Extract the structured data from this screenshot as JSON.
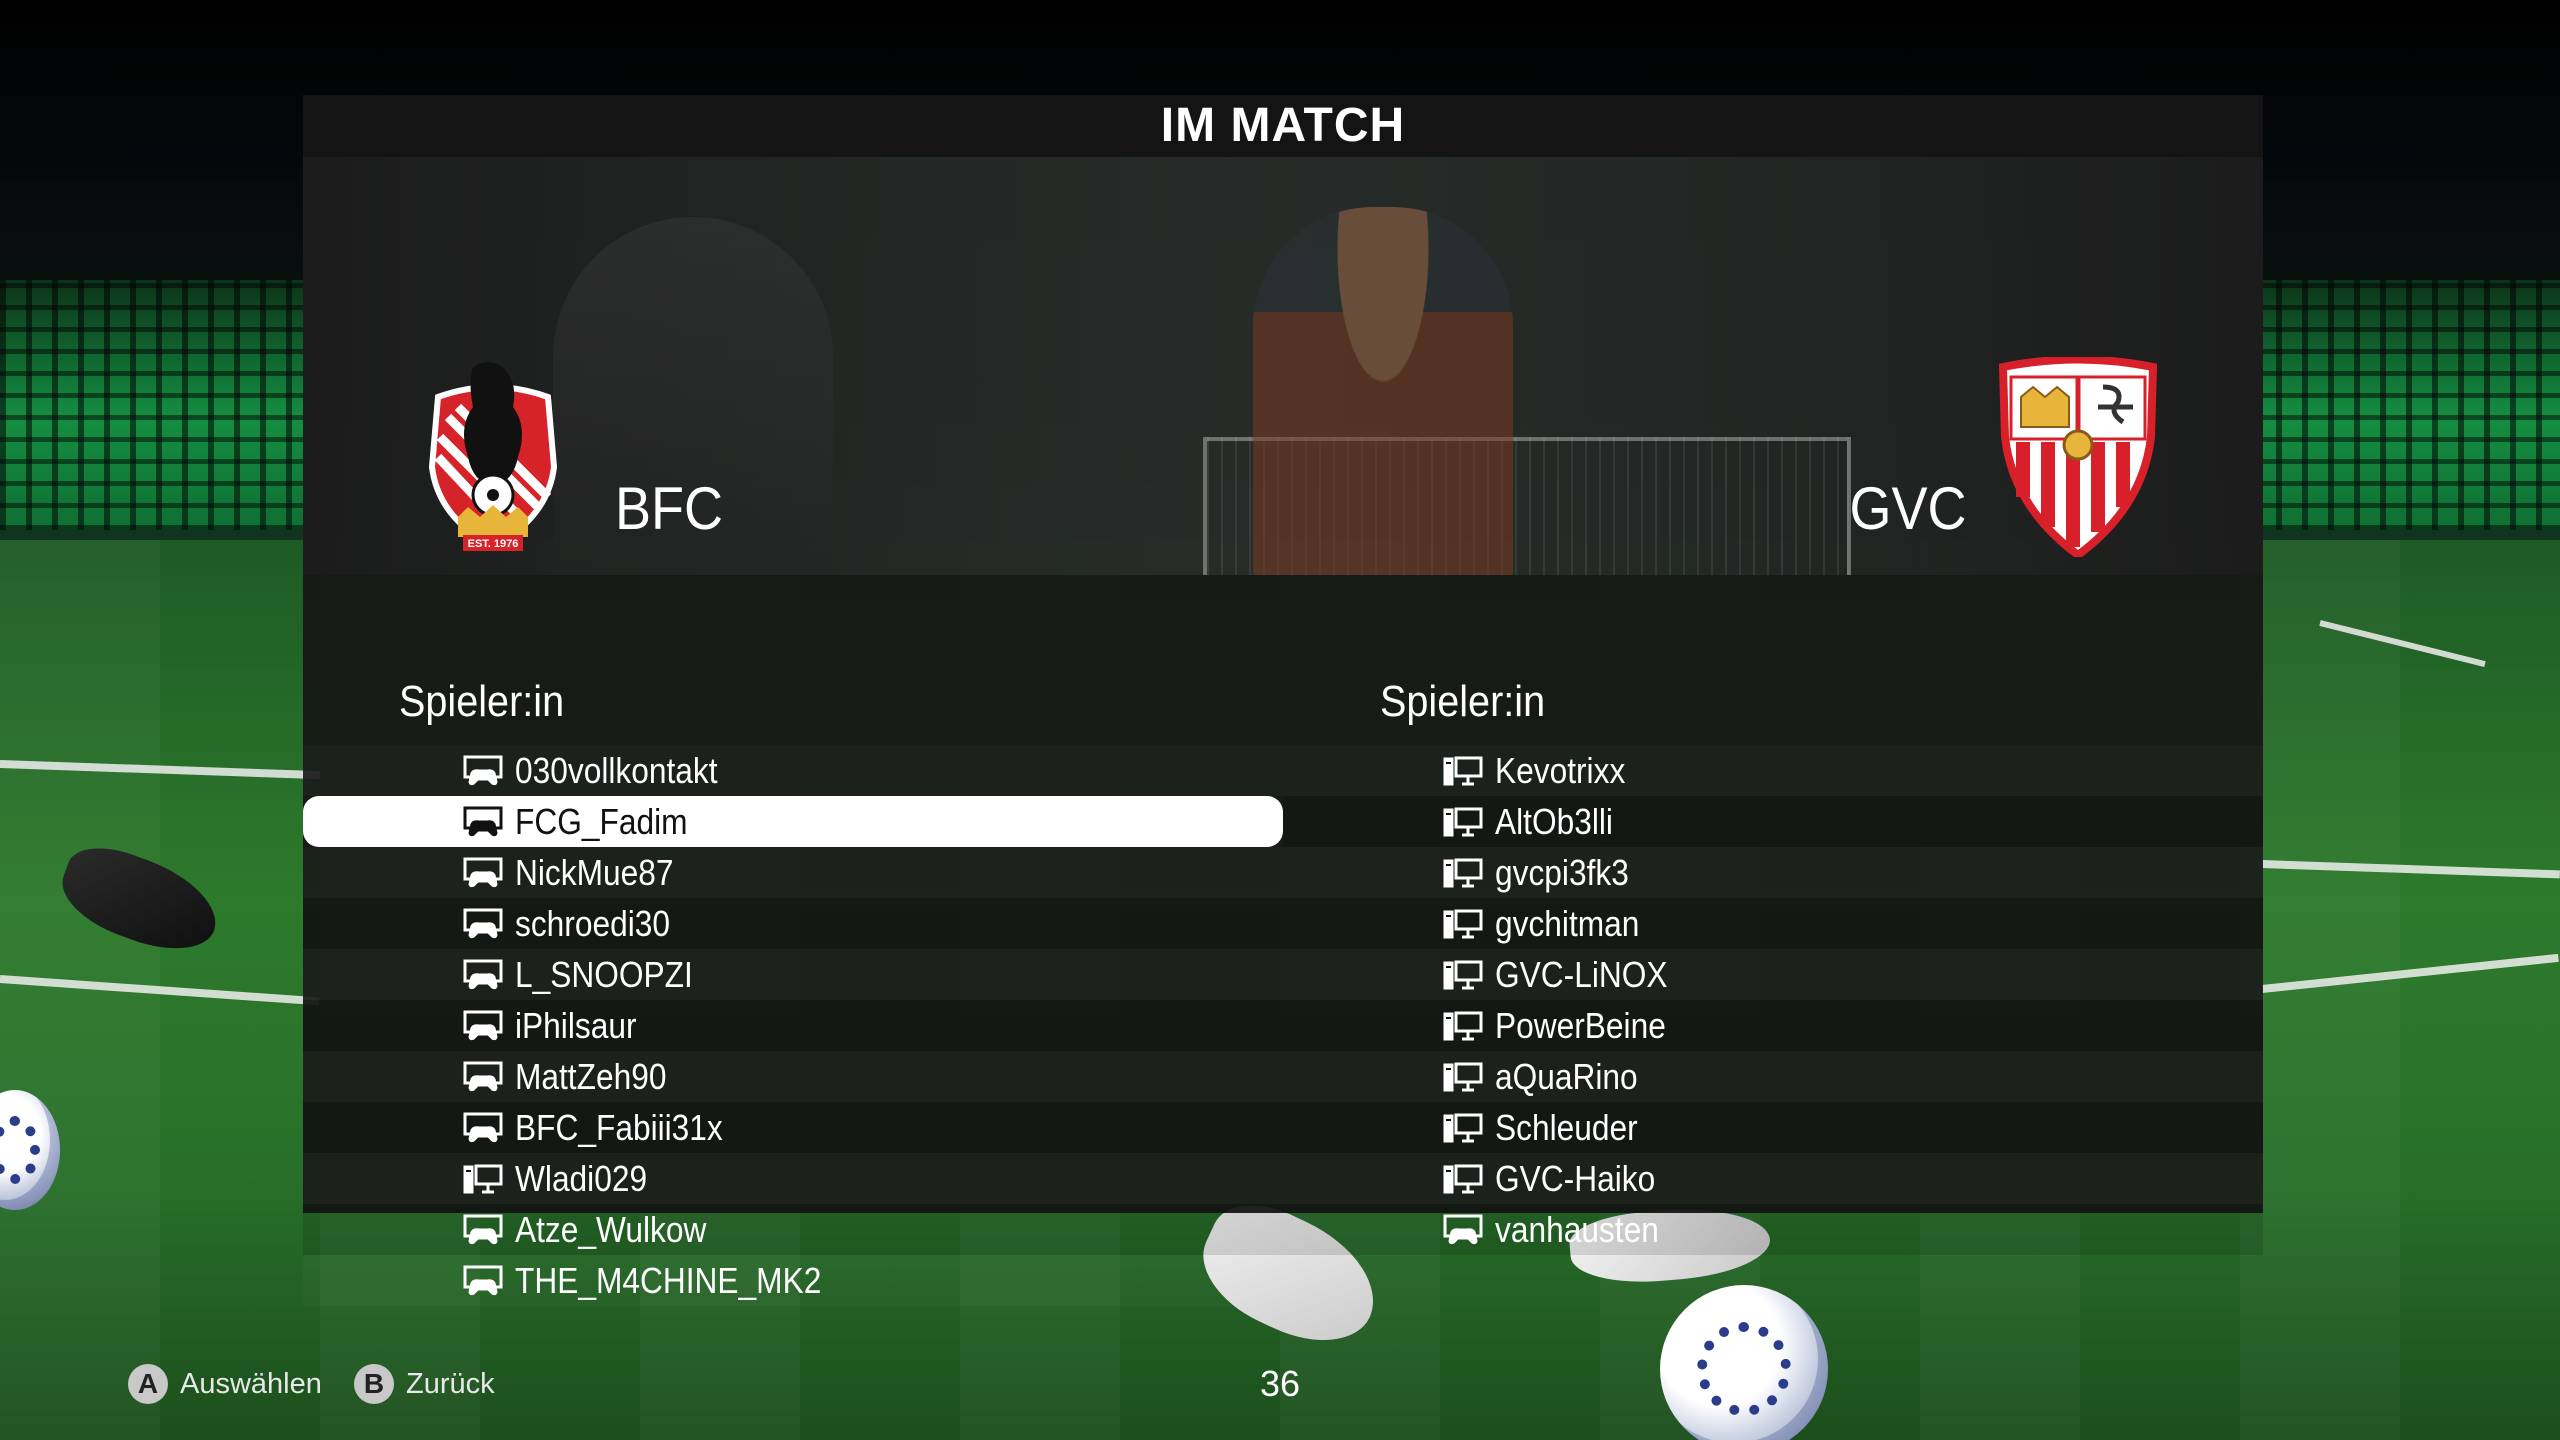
{
  "header": {
    "title": "IM MATCH"
  },
  "home_team": {
    "name": "BFC",
    "crest_text": "EST. 1976",
    "column_label": "Spieler:in",
    "players": [
      {
        "name": "030vollkontakt",
        "platform": "console-controller-icon"
      },
      {
        "name": "FCG_Fadim",
        "platform": "console-controller-icon",
        "selected": true
      },
      {
        "name": "NickMue87",
        "platform": "console-controller-icon"
      },
      {
        "name": "schroedi30",
        "platform": "console-controller-icon"
      },
      {
        "name": "L_SNOOPZI",
        "platform": "console-controller-icon"
      },
      {
        "name": "iPhilsaur",
        "platform": "console-controller-icon"
      },
      {
        "name": "MattZeh90",
        "platform": "console-controller-icon"
      },
      {
        "name": "BFC_Fabiii31x",
        "platform": "console-controller-icon"
      },
      {
        "name": "Wladi029",
        "platform": "pc-monitor-icon"
      },
      {
        "name": "Atze_Wulkow",
        "platform": "console-controller-icon"
      },
      {
        "name": "THE_M4CHINE_MK2",
        "platform": "console-controller-icon"
      }
    ]
  },
  "away_team": {
    "name": "GVC",
    "column_label": "Spieler:in",
    "players": [
      {
        "name": "Kevotrixx",
        "platform": "pc-monitor-icon"
      },
      {
        "name": "AltOb3lli",
        "platform": "pc-monitor-icon"
      },
      {
        "name": "gvcpi3fk3",
        "platform": "pc-monitor-icon"
      },
      {
        "name": "gvchitman",
        "platform": "pc-monitor-icon"
      },
      {
        "name": "GVC-LiNOX",
        "platform": "pc-monitor-icon"
      },
      {
        "name": "PowerBeine",
        "platform": "pc-monitor-icon"
      },
      {
        "name": "aQuaRino",
        "platform": "pc-monitor-icon"
      },
      {
        "name": "Schleuder",
        "platform": "pc-monitor-icon"
      },
      {
        "name": "GVC-Haiko",
        "platform": "pc-monitor-icon"
      },
      {
        "name": "vanhausten",
        "platform": "console-controller-icon"
      }
    ]
  },
  "footer": {
    "select": {
      "key": "A",
      "label": "Auswählen"
    },
    "back": {
      "key": "B",
      "label": "Zurück"
    },
    "timer": "36"
  },
  "colors": {
    "panel_bg": "#161616",
    "selected_row": "#ffffff",
    "bfc_red": "#e0262a",
    "gvc_red": "#d8202a",
    "gold": "#e7b53a"
  }
}
